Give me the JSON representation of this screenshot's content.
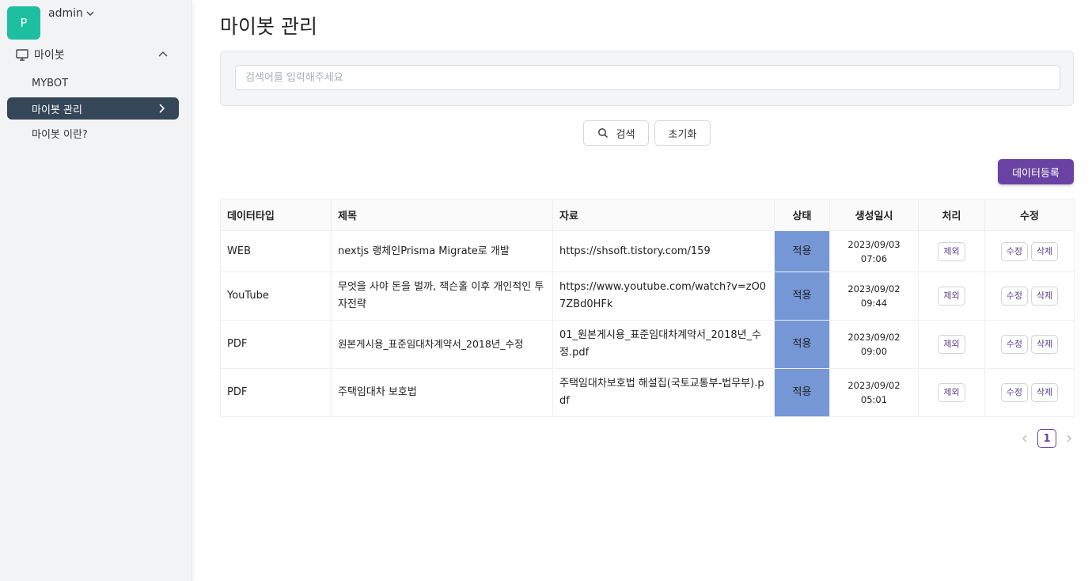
{
  "sidebar": {
    "avatar_letter": "P",
    "user_name": "admin",
    "group_label": "마이봇",
    "items": [
      {
        "label": "MYBOT"
      },
      {
        "label": "마이봇 관리"
      },
      {
        "label": "마이봇 이란?"
      }
    ]
  },
  "header": {
    "title": "마이봇 관리"
  },
  "search": {
    "placeholder": "검색어를 입력해주세요",
    "search_label": "검색",
    "reset_label": "초기화"
  },
  "actions": {
    "register_label": "데이터등록"
  },
  "table": {
    "headers": [
      "데이터타입",
      "제목",
      "자료",
      "상태",
      "생성일시",
      "처리",
      "수정"
    ],
    "rows": [
      {
        "type": "WEB",
        "title": "nextjs 랭체인Prisma Migrate로 개발",
        "source": "https://shsoft.tistory.com/159",
        "status": "적용",
        "date": "2023/09/03",
        "time": "07:06",
        "process_label": "제외",
        "edit_label": "수정",
        "delete_label": "삭제"
      },
      {
        "type": "YouTube",
        "title": "무엇을 사야 돈을 벌까, 잭슨홀 이후 개인적인 투자전략",
        "source": "https://www.youtube.com/watch?v=zO07ZBd0HFk",
        "status": "적용",
        "date": "2023/09/02",
        "time": "09:44",
        "process_label": "제외",
        "edit_label": "수정",
        "delete_label": "삭제"
      },
      {
        "type": "PDF",
        "title": "원본게시용_표준임대차계약서_2018년_수정",
        "source": "01_원본게시용_표준임대차계약서_2018년_수정.pdf",
        "status": "적용",
        "date": "2023/09/02",
        "time": "09:00",
        "process_label": "제외",
        "edit_label": "수정",
        "delete_label": "삭제"
      },
      {
        "type": "PDF",
        "title": "주택임대차 보호법",
        "source": "주택임대차보호법 해설집(국토교통부-법무부).pdf",
        "status": "적용",
        "date": "2023/09/02",
        "time": "05:01",
        "process_label": "제외",
        "edit_label": "수정",
        "delete_label": "삭제"
      }
    ]
  },
  "pagination": {
    "current": "1"
  },
  "colors": {
    "accent": "#6a42a3",
    "sidebar_active": "#344657",
    "avatar": "#1ebfa0",
    "status_cell": "#7597d6"
  }
}
